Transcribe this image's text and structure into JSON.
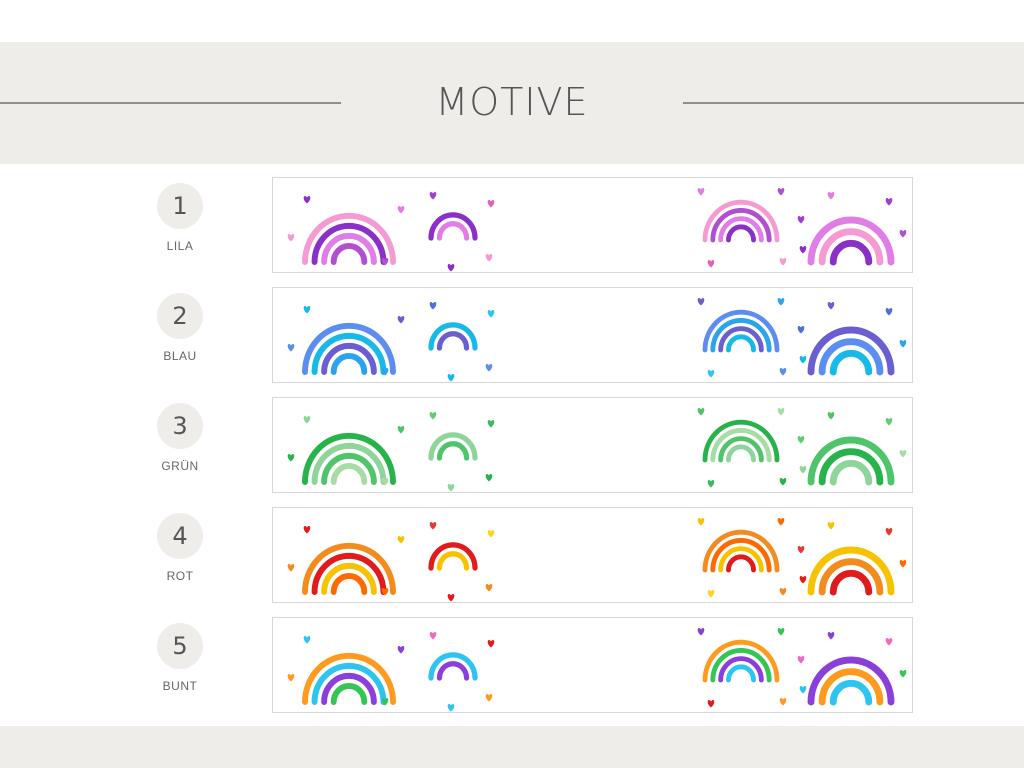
{
  "title": "MOTIVE",
  "motifs": [
    {
      "number": "1",
      "label": "LILA",
      "palette": [
        "#f59ad2",
        "#8b2fc9",
        "#e07de6",
        "#b14fd1",
        "#9b3fd6",
        "#e95fb5"
      ]
    },
    {
      "number": "2",
      "label": "BLAU",
      "palette": [
        "#5b8ef0",
        "#17b9e8",
        "#6a5ed1",
        "#2aa4ea",
        "#4f6fd8",
        "#30c4f0"
      ]
    },
    {
      "number": "3",
      "label": "GRÜN",
      "palette": [
        "#28b34a",
        "#8fd59b",
        "#4fc46a",
        "#a8dca6",
        "#63cc74",
        "#3fb95c"
      ]
    },
    {
      "number": "4",
      "label": "ROT",
      "palette": [
        "#f28c1e",
        "#e01b1b",
        "#f7c300",
        "#ff6a00",
        "#e53935",
        "#ffd21f"
      ]
    },
    {
      "number": "5",
      "label": "BUNT",
      "palette": [
        "#ff9a1f",
        "#2ec4f0",
        "#8b3fd9",
        "#34c653",
        "#f06ac0",
        "#e01b1b"
      ]
    }
  ]
}
